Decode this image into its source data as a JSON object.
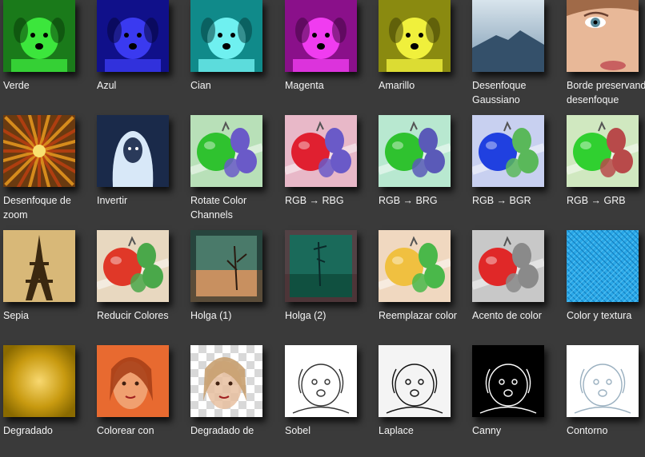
{
  "effects": [
    [
      {
        "label": "Verde",
        "kind": "puppy",
        "bg": "#1a7a1a",
        "fg": "#3ce63c",
        "accent": "#0a3d0a"
      },
      {
        "label": "Azul",
        "kind": "puppy",
        "bg": "#10108a",
        "fg": "#3a3af0",
        "accent": "#05053d"
      },
      {
        "label": "Cian",
        "kind": "puppy",
        "bg": "#108a8a",
        "fg": "#6ff0f0",
        "accent": "#054040"
      },
      {
        "label": "Magenta",
        "kind": "puppy",
        "bg": "#8a108a",
        "fg": "#f03cf0",
        "accent": "#400540"
      },
      {
        "label": "Amarillo",
        "kind": "puppy",
        "bg": "#8a8a10",
        "fg": "#f0f03c",
        "accent": "#404005"
      },
      {
        "label": "Desenfoque Gaussiano",
        "kind": "mountain"
      },
      {
        "label": "Borde preservando desenfoque",
        "kind": "face"
      }
    ],
    [
      {
        "label": "Desenfoque de zoom",
        "kind": "zoom"
      },
      {
        "label": "Invertir",
        "kind": "invert"
      },
      {
        "label": "Rotate Color Channels",
        "kind": "tomato",
        "tomato": "#2fc22f",
        "leaf": "#6a5ac8",
        "bg": "#b8e0b8"
      },
      {
        "label": "RGB → RBG",
        "kind": "tomato",
        "tomato": "#e02030",
        "leaf": "#6a5ac8",
        "bg": "#e8b8c8"
      },
      {
        "label": "RGB → BRG",
        "kind": "tomato",
        "tomato": "#2fc22f",
        "leaf": "#5a5ab8",
        "bg": "#b8e8d0"
      },
      {
        "label": "RGB → BGR",
        "kind": "tomato",
        "tomato": "#2040e0",
        "leaf": "#5ab85a",
        "bg": "#c8d0f0"
      },
      {
        "label": "RGB → GRB",
        "kind": "tomato",
        "tomato": "#30d030",
        "leaf": "#b84a4a",
        "bg": "#d0e8c0"
      }
    ],
    [
      {
        "label": "Sepia",
        "kind": "eiffel"
      },
      {
        "label": "Reducir Colores",
        "kind": "tomato",
        "tomato": "#e03828",
        "leaf": "#4aa84a",
        "bg": "#e8d8c0"
      },
      {
        "label": "Holga (1)",
        "kind": "holga1"
      },
      {
        "label": "Holga (2)",
        "kind": "holga2"
      },
      {
        "label": "Reemplazar color",
        "kind": "tomato",
        "tomato": "#f0c040",
        "leaf": "#4ab84a",
        "bg": "#f0d8c0"
      },
      {
        "label": "Acento de color",
        "kind": "tomato",
        "tomato": "#e02828",
        "leaf": "#8a8a8a",
        "bg": "#c8c8c8"
      },
      {
        "label": "Color y textura",
        "kind": "texture"
      }
    ],
    [
      {
        "label": "Degradado",
        "kind": "gradient"
      },
      {
        "label": "Colorear con",
        "kind": "girl",
        "tint": "#e86a30"
      },
      {
        "label": "Degradado de",
        "kind": "girlfade"
      },
      {
        "label": "Sobel",
        "kind": "sketch",
        "bg": "#ffffff",
        "line": "#333333"
      },
      {
        "label": "Laplace",
        "kind": "sketch",
        "bg": "#f4f4f4",
        "line": "#111111"
      },
      {
        "label": "Canny",
        "kind": "sketch",
        "bg": "#000000",
        "line": "#ffffff"
      },
      {
        "label": "Contorno",
        "kind": "sketch",
        "bg": "#ffffff",
        "line": "#9ab0c0"
      }
    ]
  ]
}
